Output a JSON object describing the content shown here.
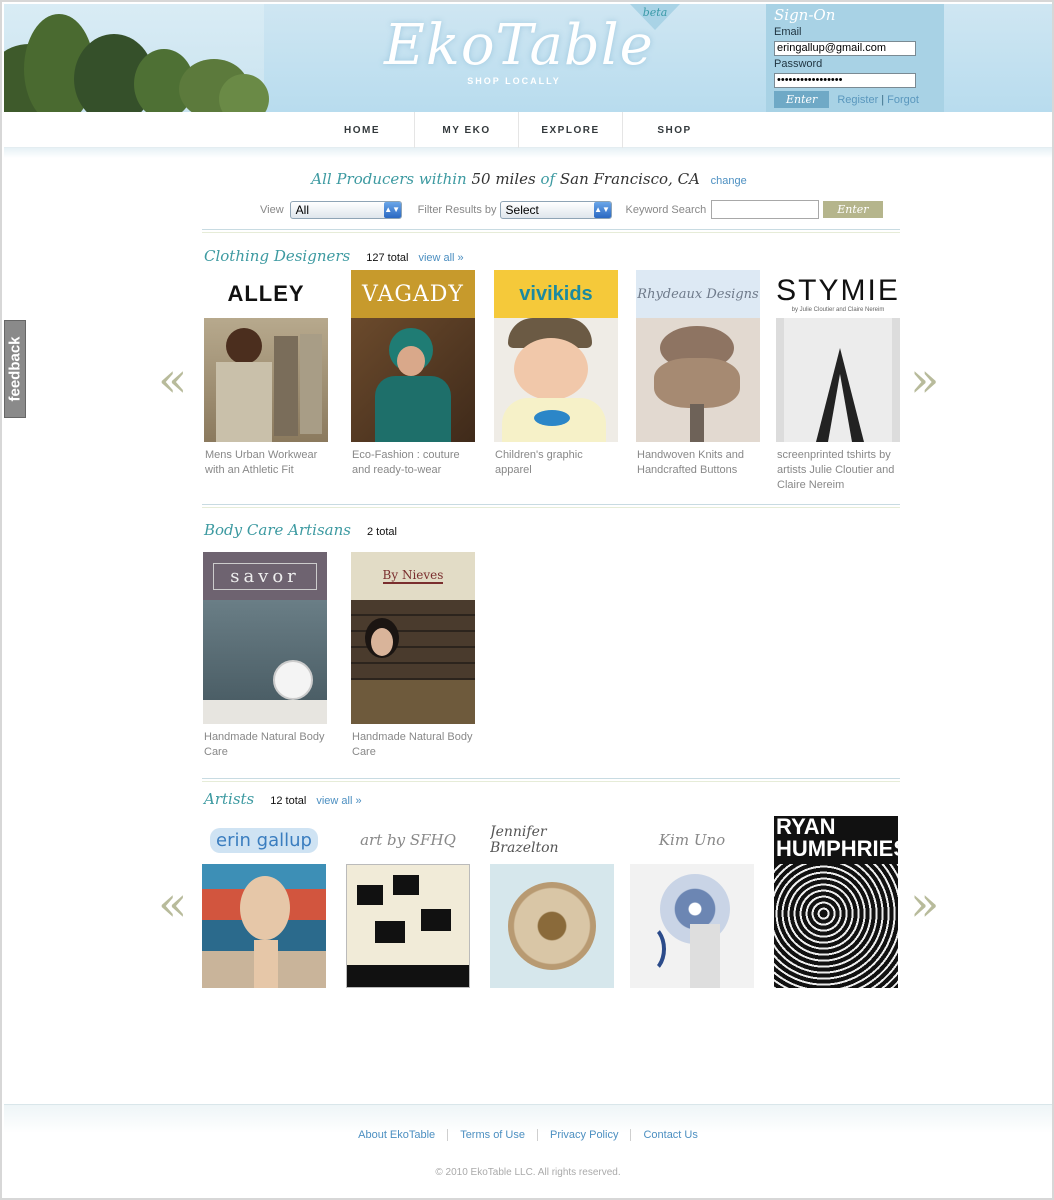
{
  "header": {
    "logo_title": "EkoTable",
    "logo_tagline": "SHOP LOCALLY",
    "beta_label": "beta",
    "signon": {
      "title": "Sign-On",
      "email_label": "Email",
      "email_value": "eringallup@gmail.com",
      "password_label": "Password",
      "password_value": "•••••••••••••••••",
      "enter_label": "Enter",
      "register_label": "Register",
      "forgot_label": "Forgot"
    }
  },
  "nav": {
    "items": [
      {
        "label": "HOME"
      },
      {
        "label": "MY EKO"
      },
      {
        "label": "EXPLORE"
      },
      {
        "label": "SHOP"
      }
    ]
  },
  "search": {
    "intro": "All Producers within",
    "distance": "50 miles",
    "of": "of",
    "location": "San Francisco, CA",
    "change_label": "change",
    "view_label": "View",
    "view_value": "All",
    "filter_label": "Filter Results by",
    "filter_value": "Select",
    "keyword_label": "Keyword Search",
    "keyword_value": "",
    "enter_label": "Enter"
  },
  "feedback_label": "feedback",
  "prev_arrow": "«",
  "next_arrow": "»",
  "sections": {
    "clothing": {
      "title": "Clothing Designers",
      "count": "127 total",
      "view_all": "view all »",
      "cards": [
        {
          "banner": "ALLEY",
          "desc": "Mens Urban Workwear with an Athletic Fit"
        },
        {
          "banner": "VAGADY",
          "desc": "Eco-Fashion : couture and ready-to-wear"
        },
        {
          "banner": "vivikids",
          "desc": "Children's graphic apparel"
        },
        {
          "banner": "Rhydeaux Designs",
          "desc": "Handwoven Knits and Handcrafted Buttons"
        },
        {
          "banner": "STYMIE",
          "banner_sub": "by Julie Cloutier and Claire Nereim",
          "desc": "screenprinted tshirts by artists Julie Cloutier and Claire Nereim"
        }
      ]
    },
    "body_care": {
      "title": "Body Care Artisans",
      "count": "2 total",
      "cards": [
        {
          "banner": "savor",
          "desc": "Handmade Natural Body Care"
        },
        {
          "banner": "By Nieves",
          "desc": "Handmade Natural Body Care"
        }
      ]
    },
    "artists": {
      "title": "Artists",
      "count": "12 total",
      "view_all": "view all »",
      "cards": [
        {
          "banner": "erin gallup"
        },
        {
          "banner": "art by SFHQ"
        },
        {
          "banner": "Jennifer Brazelton"
        },
        {
          "banner": "Kim Uno"
        },
        {
          "banner": "RYAN HUMPHRIES"
        }
      ]
    }
  },
  "footer": {
    "links": [
      {
        "label": "About EkoTable"
      },
      {
        "label": "Terms of Use"
      },
      {
        "label": "Privacy Policy"
      },
      {
        "label": "Contact Us"
      }
    ],
    "copyright": "© 2010 EkoTable LLC. All rights reserved."
  }
}
